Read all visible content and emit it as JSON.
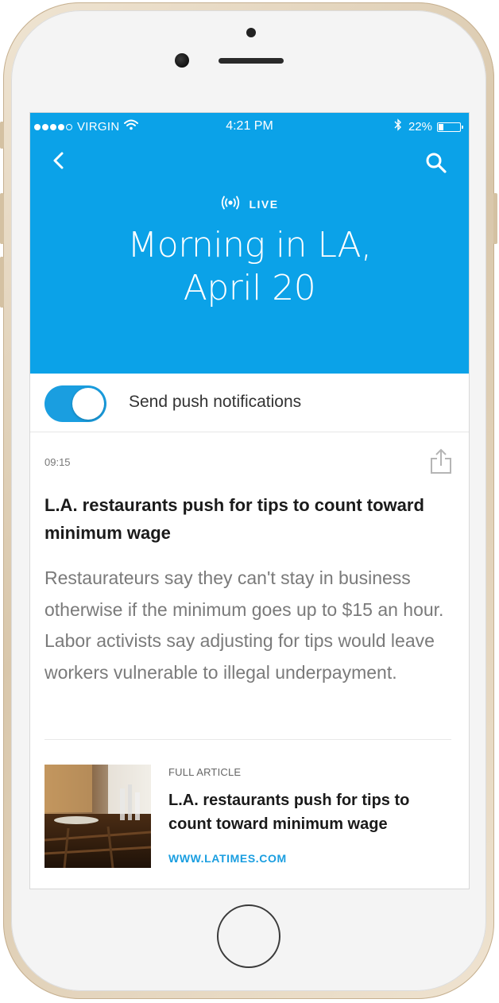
{
  "status_bar": {
    "carrier": "VIRGIN",
    "signal_bars": 4,
    "signal_total": 5,
    "time": "4:21 PM",
    "battery_percent": "22%",
    "battery_level": 0.22
  },
  "header": {
    "live_label": "LIVE",
    "title_line1": "Morning in LA,",
    "title_line2": "April 20",
    "background_color": "#0ba2e8"
  },
  "push_notifications": {
    "label": "Send push notifications",
    "enabled": true,
    "toggle_color": "#1a9ee0"
  },
  "post": {
    "time": "09:15",
    "headline": "L.A. restaurants push for tips to count toward minimum wage",
    "body": "Restaurateurs say they can't stay in business otherwise if the minimum goes up to $15 an hour. Labor activists say adjusting for tips would leave workers vulnerable to illegal underpayment."
  },
  "article_card": {
    "kicker": "FULL ARTICLE",
    "headline": "L.A. restaurants push for tips to count toward minimum wage",
    "source": "WWW.LATIMES.COM",
    "source_color": "#1a9ee0"
  },
  "icons": {
    "back": "chevron-left-icon",
    "search": "search-icon",
    "live": "broadcast-icon",
    "share": "share-icon",
    "wifi": "wifi-icon",
    "bluetooth": "bluetooth-icon",
    "battery": "battery-icon"
  }
}
